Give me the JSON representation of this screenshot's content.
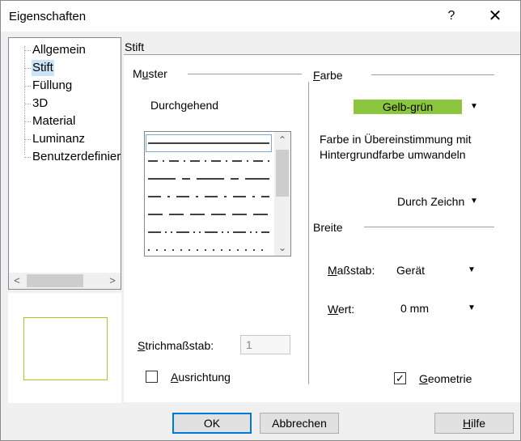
{
  "window": {
    "title": "Eigenschaften",
    "help_glyph": "?",
    "close_glyph": "✕"
  },
  "tree": {
    "items": [
      {
        "label": "Allgemein"
      },
      {
        "label": "Stift"
      },
      {
        "label": "Füllung"
      },
      {
        "label": "3D"
      },
      {
        "label": "Material"
      },
      {
        "label": "Luminanz"
      },
      {
        "label": "Benutzerdefinier"
      }
    ],
    "selected": "Stift",
    "scroll_left": "<",
    "scroll_right": ">"
  },
  "section": {
    "title": "Stift"
  },
  "muster": {
    "label_before": "M",
    "label_mnemonic": "u",
    "label_after": "ster",
    "current": "Durchgehend",
    "scroll_up": "⌃",
    "scroll_down": "⌄"
  },
  "strichmassstab": {
    "label_mnemonic": "S",
    "label_rest": "trichmaßstab:",
    "value": "1"
  },
  "ausrichtung": {
    "label_mnemonic": "A",
    "label_rest": "usrichtung",
    "checked": false
  },
  "farbe": {
    "label_before": "",
    "label_mnemonic": "F",
    "label_after": "arbe",
    "value": "Gelb-grün",
    "swatch_color": "#8cc63e",
    "caret": "▼",
    "convert_text_line1": "Farbe in Übereinstimmung mit",
    "convert_text_line2": "Hintergrundfarbe umwandeln",
    "convert_value": "Durch Zeichn"
  },
  "breite": {
    "label": "Breite",
    "massstab_mnemonic": "M",
    "massstab_rest": "aßstab:",
    "massstab_value": "Gerät",
    "wert_mnemonic": "W",
    "wert_rest": "ert:",
    "wert_value": "0 mm"
  },
  "geometrie": {
    "label_mnemonic": "G",
    "label_rest": "eometrie",
    "checked": true,
    "check_glyph": "✓"
  },
  "buttons": {
    "ok": "OK",
    "cancel": "Abbrechen",
    "help_mnemonic": "H",
    "help_rest": "ilfe"
  }
}
